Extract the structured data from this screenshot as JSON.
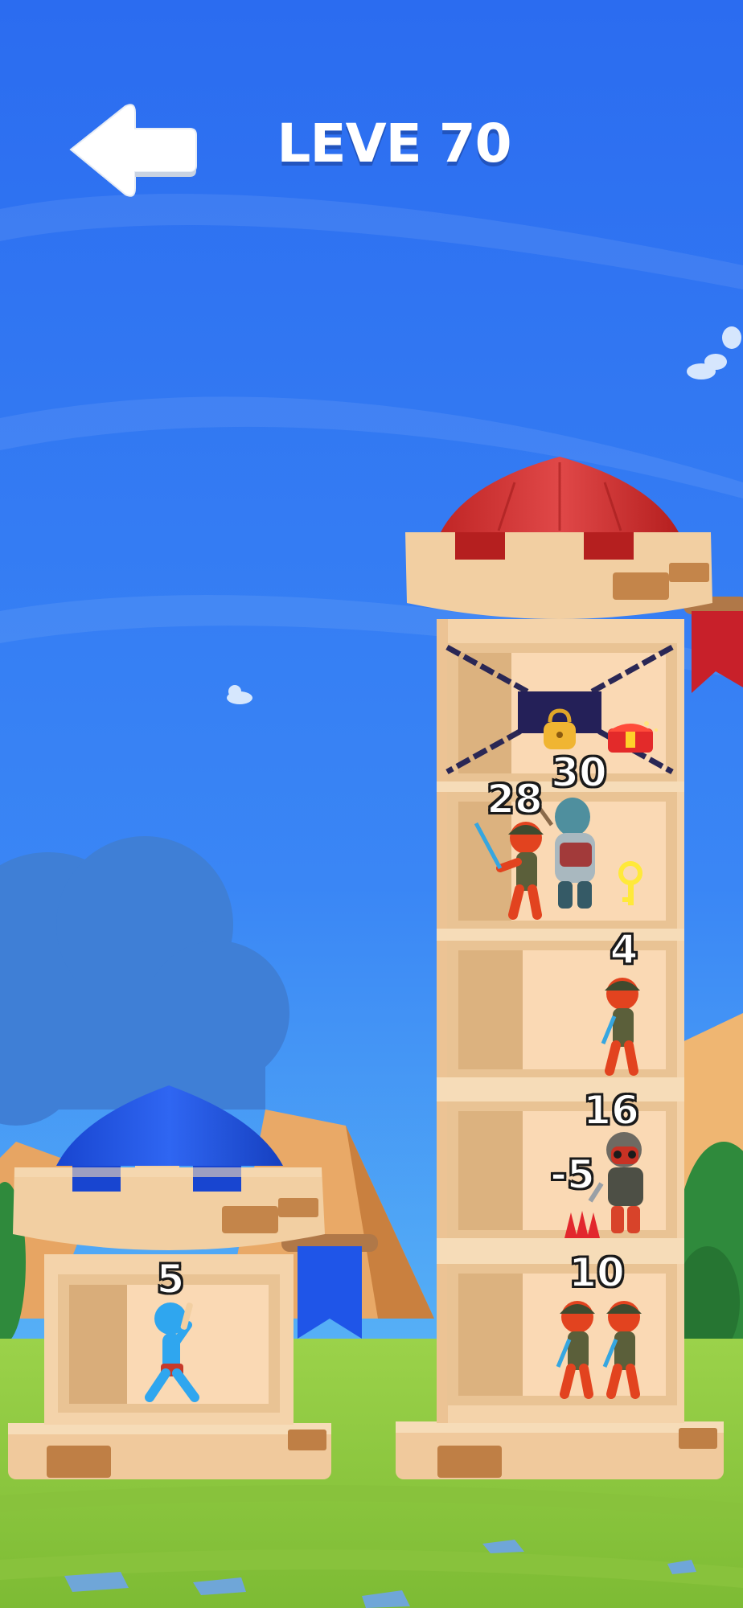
{
  "hud": {
    "level_title": "LEVE 70",
    "back_icon": "arrow-left-icon"
  },
  "player_tower": {
    "hero_power": "5",
    "roof_color": "#1f55e8",
    "flag_color": "#1f55e8"
  },
  "enemy_tower": {
    "roof_color": "#d63232",
    "flag_color": "#c8202a",
    "floors": [
      {
        "floor": 1,
        "locked": true,
        "contents": [
          "padlock-icon",
          "treasure-chest-icon"
        ]
      },
      {
        "floor": 2,
        "enemy_powers": [
          "28",
          "30"
        ],
        "contents": [
          "key-icon"
        ]
      },
      {
        "floor": 3,
        "enemy_powers": [
          "4"
        ]
      },
      {
        "floor": 4,
        "enemy_powers": [
          "16"
        ],
        "trap_value": "-5",
        "contents": [
          "spike-trap-icon"
        ]
      },
      {
        "floor": 5,
        "enemy_powers": [
          "10"
        ]
      }
    ]
  },
  "colors": {
    "sky_top": "#2a6ff0",
    "sky_bottom": "#5fc0f5",
    "grass": "#8cc63f",
    "tower_wall": "#f4d3aa"
  }
}
